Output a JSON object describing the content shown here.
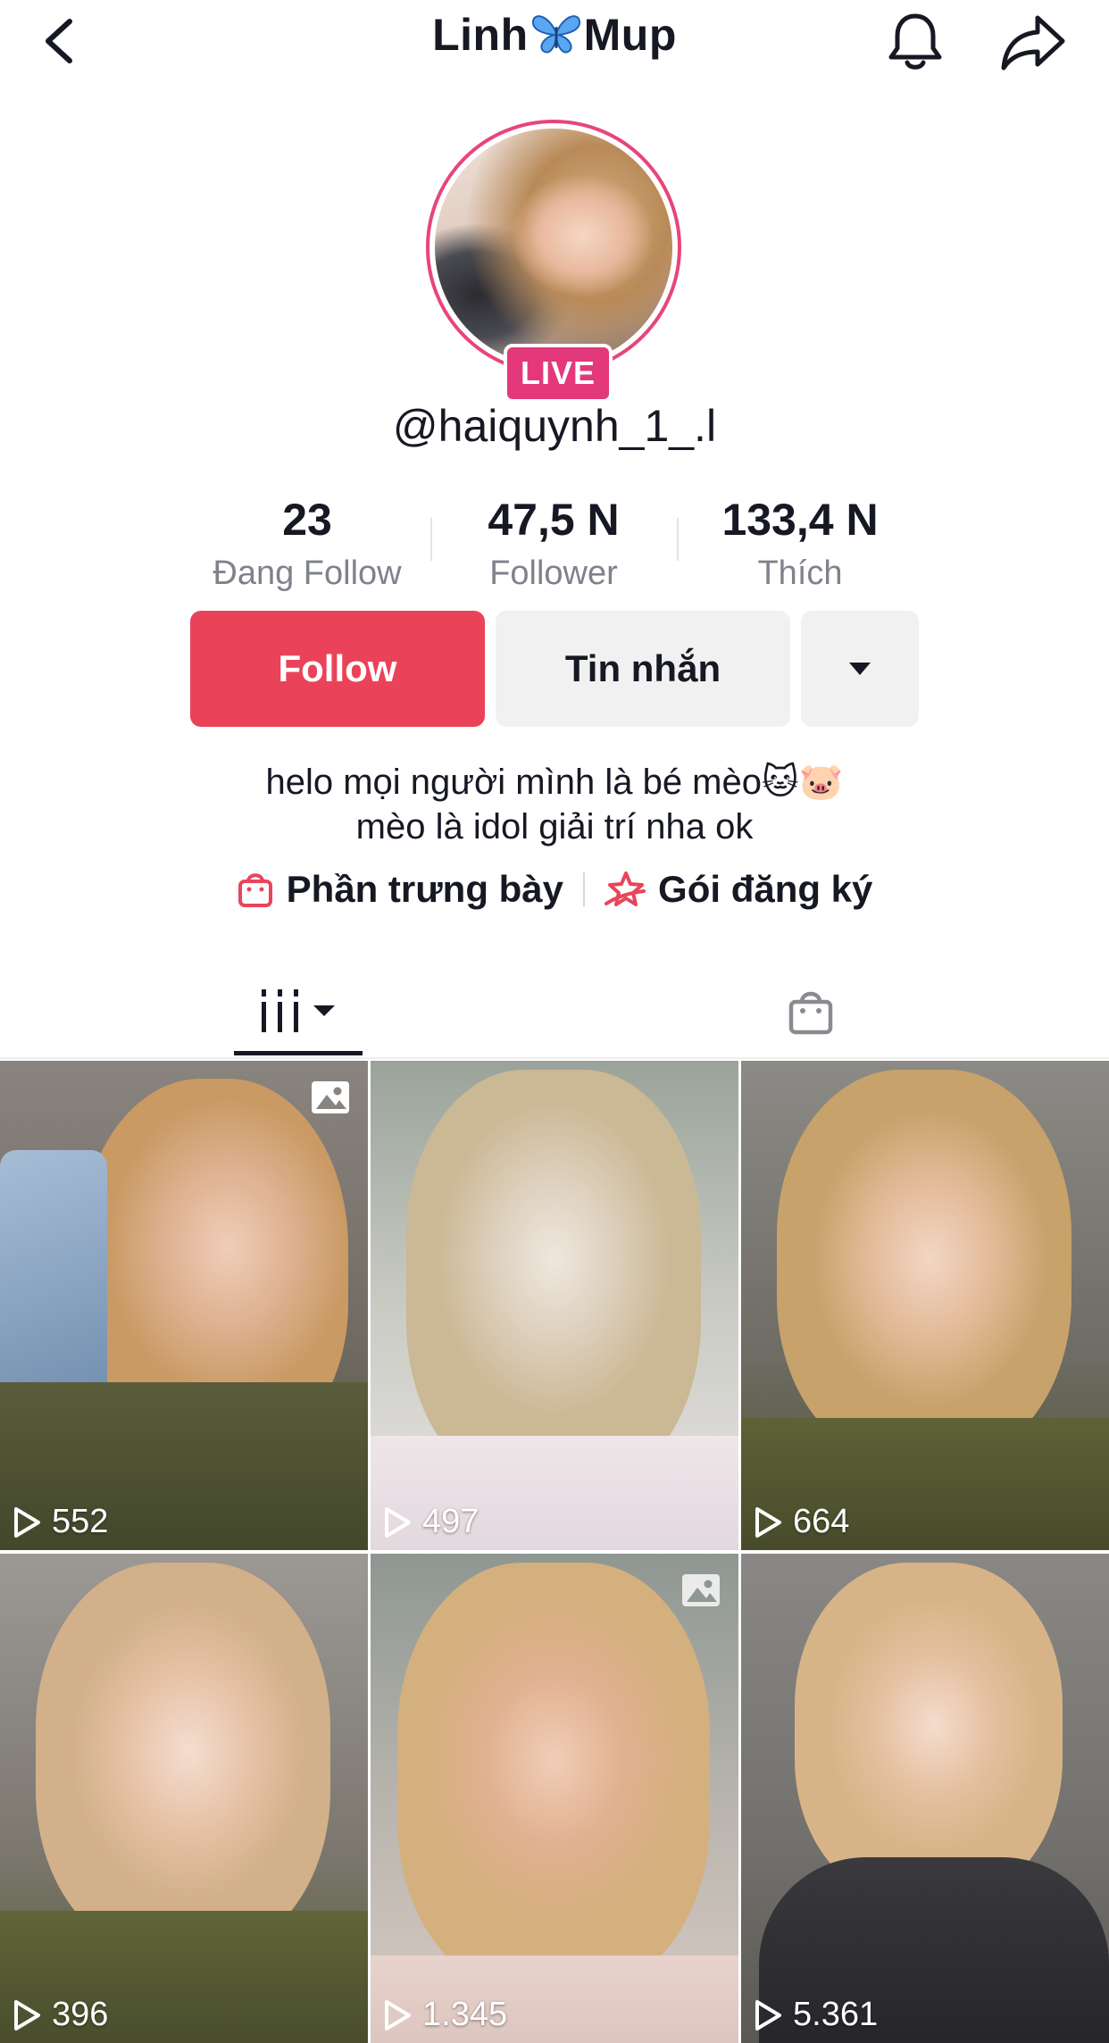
{
  "header": {
    "title_left": "Linh",
    "title_right": "Mup",
    "icons": [
      "back-icon",
      "butterfly-icon",
      "bell-icon",
      "share-icon"
    ]
  },
  "profile": {
    "live_badge": "LIVE",
    "handle": "@haiquynh_1_.l"
  },
  "stats": [
    {
      "value": "23",
      "label": "Đang Follow"
    },
    {
      "value": "47,5 N",
      "label": "Follower"
    },
    {
      "value": "133,4 N",
      "label": "Thích"
    }
  ],
  "actions": {
    "follow": "Follow",
    "message": "Tin nhắn"
  },
  "bio": {
    "line1": "helo mọi người mình là bé mèo🐱🐷",
    "line2": "mèo là idol giải trí nha ok"
  },
  "links": {
    "showcase": "Phần trưng bày",
    "subscription": "Gói đăng ký"
  },
  "colors": {
    "follow": "#ea4359",
    "live": "#e3397a",
    "text": "#161823",
    "secondary_text": "#7f828b"
  },
  "videos": [
    {
      "views": "552",
      "photo": true
    },
    {
      "views": "497",
      "photo": false
    },
    {
      "views": "664",
      "photo": false
    },
    {
      "views": "396",
      "photo": false
    },
    {
      "views": "1.345",
      "photo": true
    },
    {
      "views": "5.361",
      "photo": false
    }
  ]
}
